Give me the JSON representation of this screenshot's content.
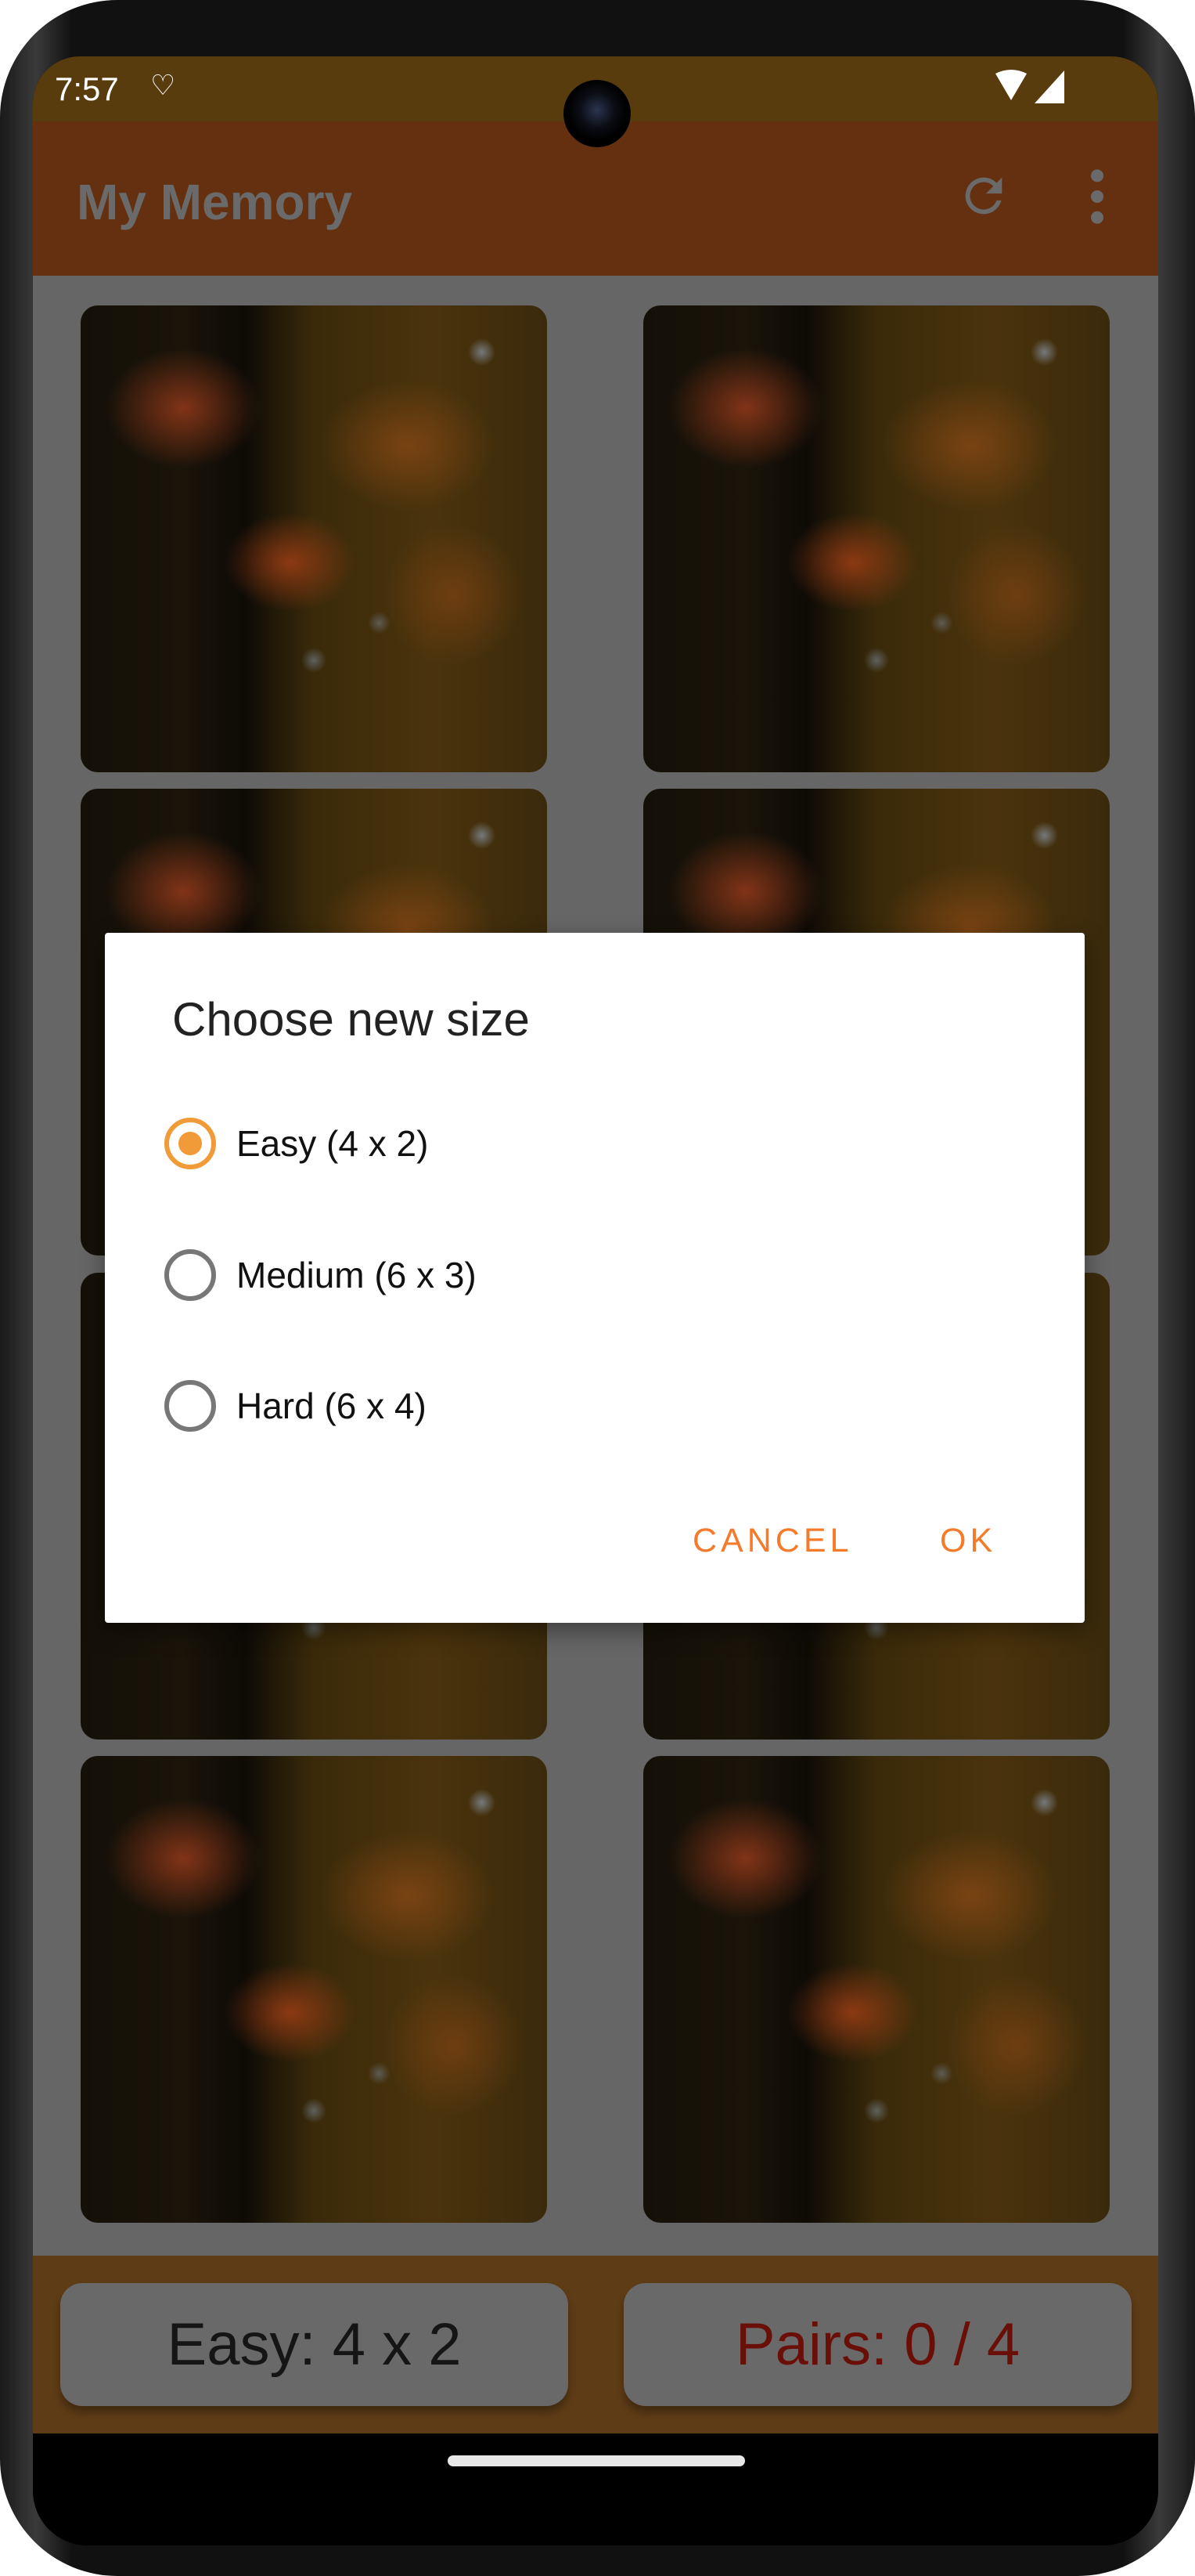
{
  "status_bar": {
    "time": "7:57"
  },
  "app_bar": {
    "title": "My Memory",
    "refresh_icon": "refresh-icon",
    "menu_icon": "more-vert-icon"
  },
  "board": {
    "cards": 8,
    "columns": 2,
    "rows": 4
  },
  "bottom_bar": {
    "difficulty_label": "Easy: 4 x 2",
    "pairs_label": "Pairs: 0 / 4",
    "pairs_color": "#6a0f08"
  },
  "dialog": {
    "title": "Choose new size",
    "options": [
      {
        "label": "Easy (4 x 2)",
        "selected": true
      },
      {
        "label": "Medium (6 x 3)",
        "selected": false
      },
      {
        "label": "Hard (6 x 4)",
        "selected": false
      }
    ],
    "cancel_label": "CANCEL",
    "ok_label": "OK",
    "accent": "#F57A2A"
  }
}
